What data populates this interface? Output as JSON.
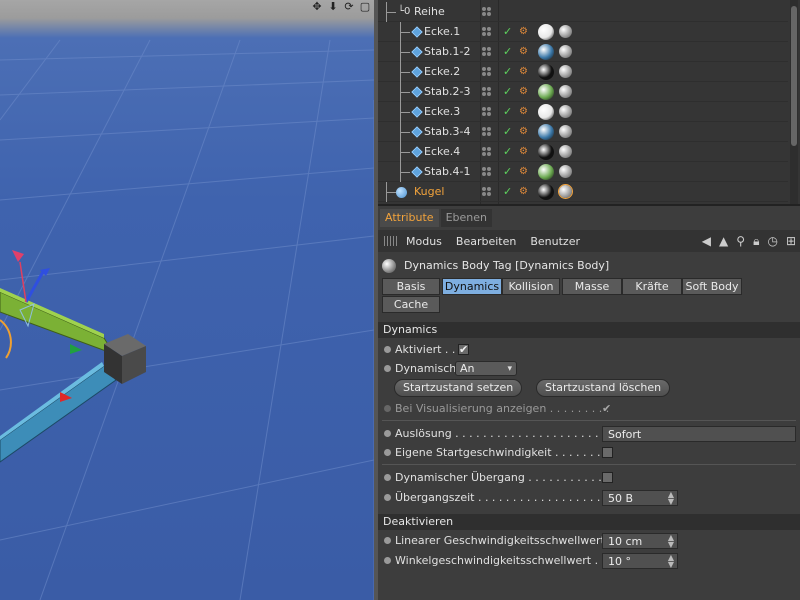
{
  "viewport": {
    "toolbar_icons": [
      "move-icon",
      "arrow-down-icon",
      "rotate-icon",
      "layout-icon"
    ]
  },
  "object_manager": {
    "objects": [
      {
        "name": "Reihe",
        "type": "null",
        "level": 0
      },
      {
        "name": "Ecke.1",
        "type": "cube",
        "level": 1,
        "material": "white"
      },
      {
        "name": "Stab.1-2",
        "type": "cube",
        "level": 1,
        "material": "blue"
      },
      {
        "name": "Ecke.2",
        "type": "cube",
        "level": 1,
        "material": "black"
      },
      {
        "name": "Stab.2-3",
        "type": "cube",
        "level": 1,
        "material": "green"
      },
      {
        "name": "Ecke.3",
        "type": "cube",
        "level": 1,
        "material": "white"
      },
      {
        "name": "Stab.3-4",
        "type": "cube",
        "level": 1,
        "material": "blue"
      },
      {
        "name": "Ecke.4",
        "type": "cube",
        "level": 1,
        "material": "black"
      },
      {
        "name": "Stab.4-1",
        "type": "cube",
        "level": 1,
        "material": "green"
      },
      {
        "name": "Kugel",
        "type": "sphere",
        "level": 0,
        "material": "black",
        "selected": true
      }
    ],
    "material_colors": {
      "white": "#e8e8e8",
      "blue": "#3b78a8",
      "black": "#111111",
      "green": "#6aa84f"
    }
  },
  "attributes": {
    "tabs": [
      {
        "label": "Attribute",
        "active": true
      },
      {
        "label": "Ebenen",
        "active": false
      }
    ],
    "menu": [
      "Modus",
      "Bearbeiten",
      "Benutzer"
    ],
    "title": "Dynamics Body Tag [Dynamics Body]",
    "body_tabs": [
      "Basis",
      "Dynamics",
      "Kollision",
      "Masse",
      "Kräfte",
      "Soft Body",
      "Cache"
    ],
    "active_body_tab": "Dynamics",
    "dynamics_header": "Dynamics",
    "aktiviert": {
      "label": "Aktiviert . . .",
      "checked": true
    },
    "dynamisch": {
      "label": "Dynamisch",
      "value": "An"
    },
    "btn_set": "Startzustand setzen",
    "btn_clear": "Startzustand löschen",
    "visualisierung": {
      "label": "Bei Visualisierung anzeigen . . . . . . . . .",
      "checked": true
    },
    "ausloesung": {
      "label": "Auslösung . . . . . . . . . . . . . . . . . . . . . .",
      "value": "Sofort"
    },
    "eigene_start": {
      "label": "Eigene Startgeschwindigkeit . . . . . . . .",
      "checked": false
    },
    "dyn_uebergang": {
      "label": "Dynamischer Übergang . . . . . . . . . . . .",
      "checked": false
    },
    "uebergangszeit": {
      "label": "Übergangszeit . . . . . . . . . . . . . . . . . . . .",
      "value": "50 B"
    },
    "deaktivieren_header": "Deaktivieren",
    "linear": {
      "label": "Linearer Geschwindigkeitsschwellwert",
      "value": "10 cm"
    },
    "winkel": {
      "label": "Winkelgeschwindigkeitsschwellwert  .",
      "value": "10 °"
    }
  }
}
